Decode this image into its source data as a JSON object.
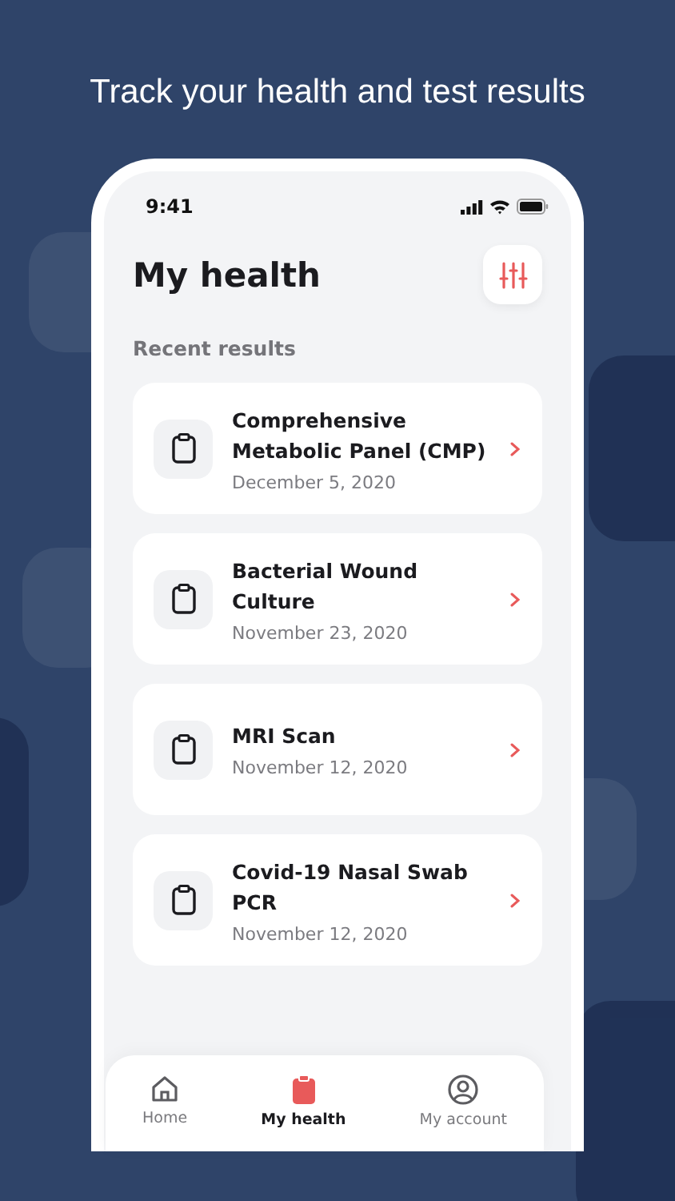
{
  "headline": "Track your health and test results",
  "status_bar": {
    "time": "9:41"
  },
  "header": {
    "title": "My health"
  },
  "section": {
    "title": "Recent results"
  },
  "results": [
    {
      "name": "Comprehensive Metabolic Panel (CMP)",
      "date": "December 5, 2020"
    },
    {
      "name": "Bacterial Wound Culture",
      "date": "November 23, 2020"
    },
    {
      "name": "MRI Scan",
      "date": "November 12, 2020"
    },
    {
      "name": "Covid-19 Nasal Swab PCR",
      "date": "November 12, 2020"
    }
  ],
  "tab_bar": [
    {
      "kind": "home",
      "label": "Home",
      "selected": false
    },
    {
      "kind": "health",
      "label": "My health",
      "selected": true
    },
    {
      "kind": "account",
      "label": "My account",
      "selected": false
    }
  ]
}
